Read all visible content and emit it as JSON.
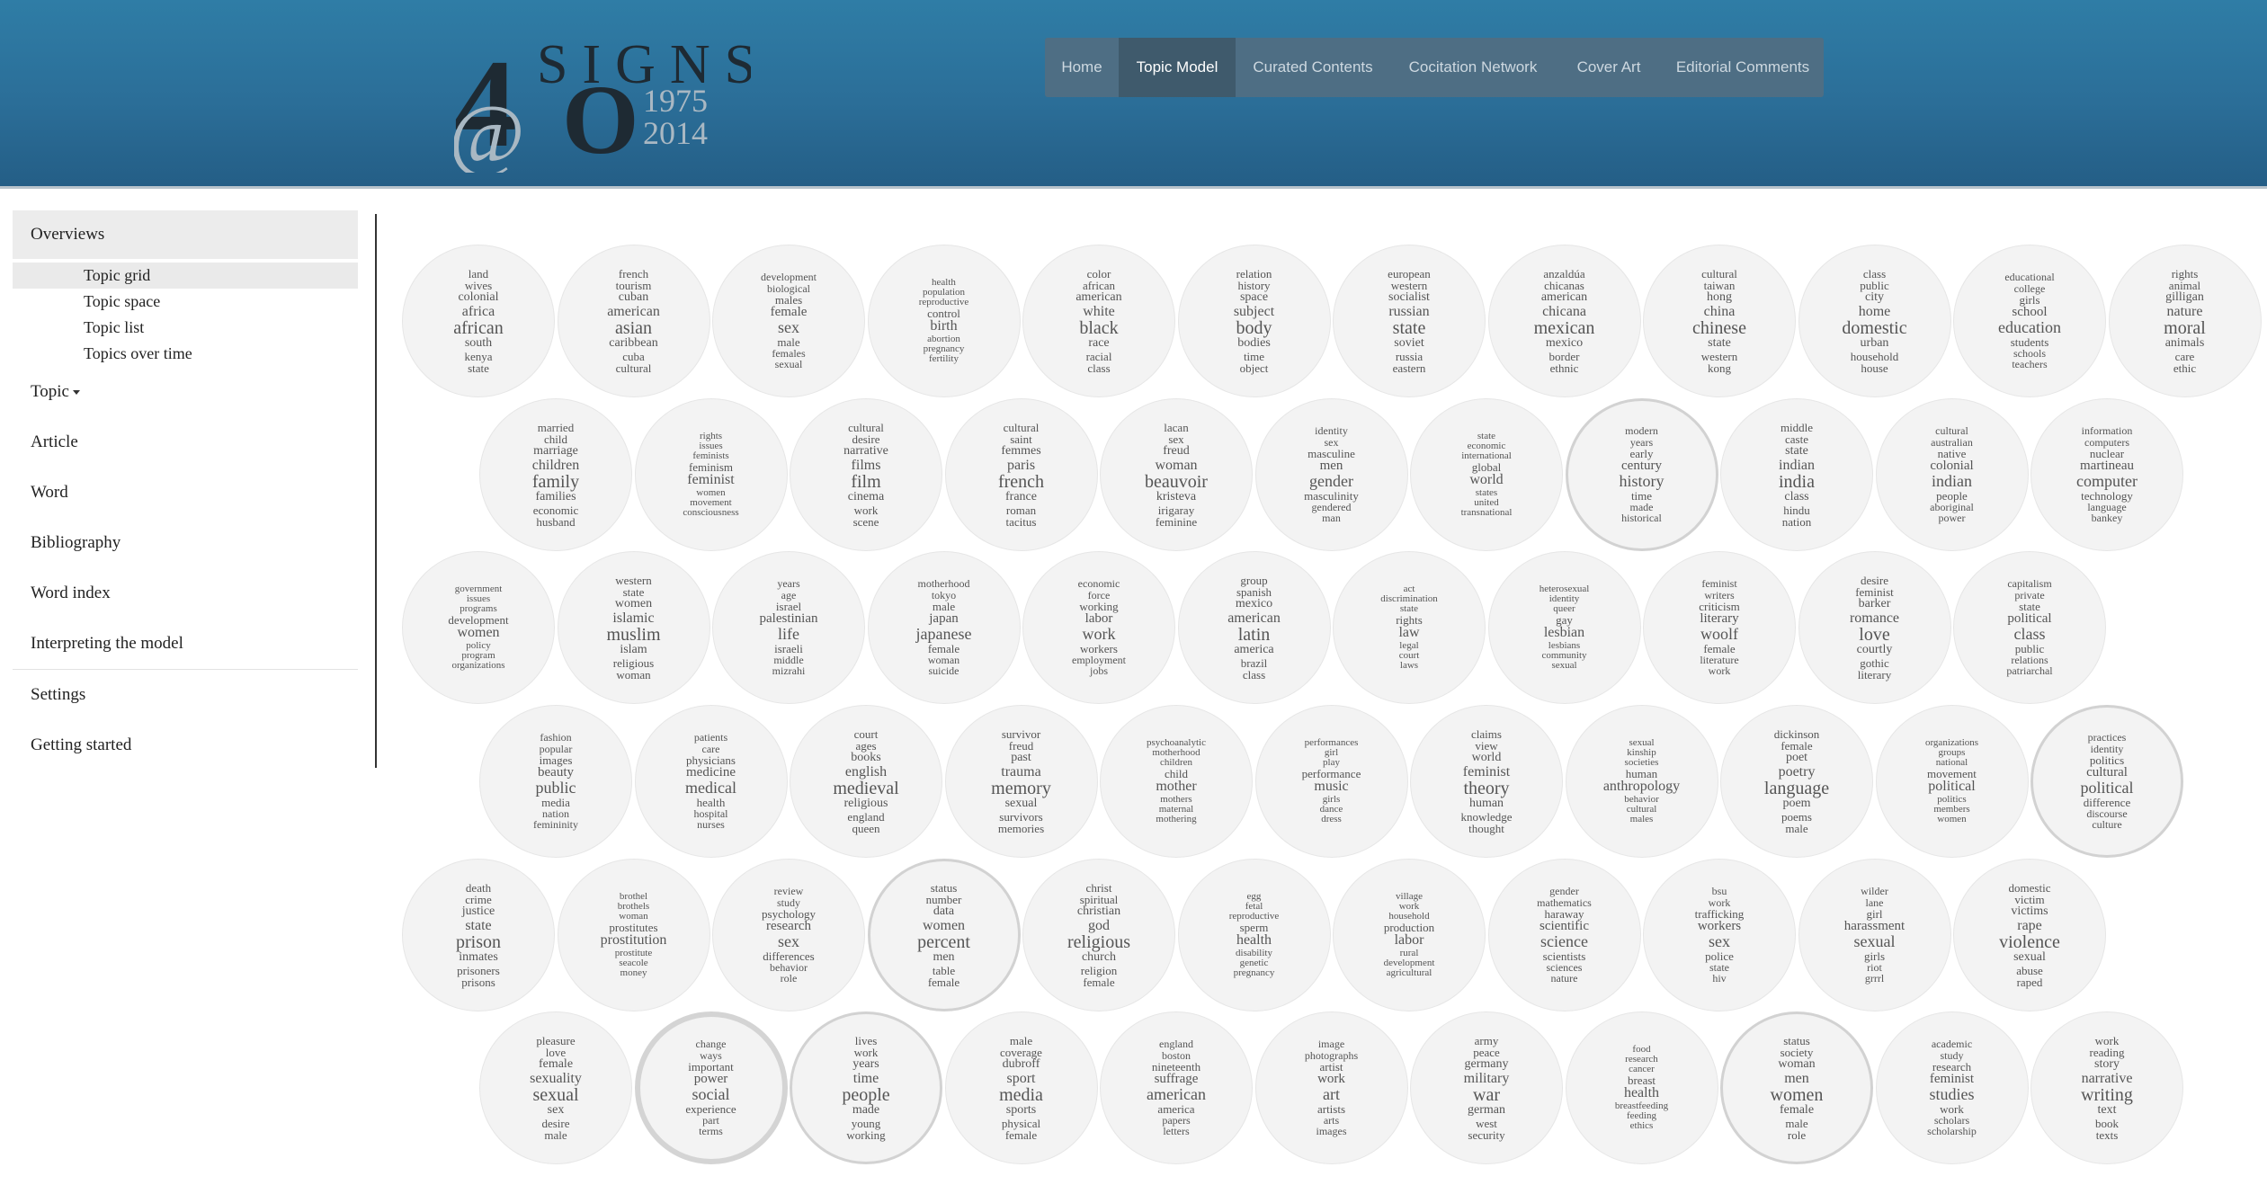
{
  "logo": {
    "numeral": "4",
    "word": "SIGNS",
    "at": "@",
    "zero": "O",
    "year_start": "1975",
    "year_end": "2014"
  },
  "nav": {
    "items": [
      {
        "label": "Home",
        "active": false
      },
      {
        "label": "Topic Model",
        "active": true
      },
      {
        "label": "Curated Contents",
        "active": false
      },
      {
        "label": "Cocitation Network",
        "active": false
      },
      {
        "label": "Cover Art",
        "active": false
      },
      {
        "label": "Editorial Comments",
        "active": false
      }
    ]
  },
  "sidebar": {
    "overviews_label": "Overviews",
    "overview_items": [
      "Topic grid",
      "Topic space",
      "Topic list",
      "Topics over time"
    ],
    "selected_overview": "Topic grid",
    "topic_label": "Topic",
    "sections": [
      "Article",
      "Word",
      "Bibliography",
      "Word index",
      "Interpreting the model"
    ],
    "bottom_sections": [
      "Settings",
      "Getting started"
    ]
  },
  "topic_rows": [
    [
      [
        "land",
        "wives",
        "colonial",
        "africa",
        "african",
        "south",
        "kenya",
        "state"
      ],
      [
        "french",
        "tourism",
        "cuban",
        "american",
        "asian",
        "caribbean",
        "cuba",
        "cultural"
      ],
      [
        "development",
        "biological",
        "males",
        "female",
        "sex",
        "male",
        "females",
        "sexual"
      ],
      [
        "health",
        "population",
        "reproductive",
        "control",
        "birth",
        "abortion",
        "pregnancy",
        "fertility"
      ],
      [
        "color",
        "african",
        "american",
        "white",
        "black",
        "race",
        "racial",
        "class"
      ],
      [
        "relation",
        "history",
        "space",
        "subject",
        "body",
        "bodies",
        "time",
        "object"
      ],
      [
        "european",
        "western",
        "socialist",
        "russian",
        "state",
        "soviet",
        "russia",
        "eastern"
      ],
      [
        "anzaldúa",
        "chicanas",
        "american",
        "chicana",
        "mexican",
        "mexico",
        "border",
        "ethnic"
      ],
      [
        "cultural",
        "taiwan",
        "hong",
        "china",
        "chinese",
        "state",
        "western",
        "kong"
      ],
      [
        "class",
        "public",
        "city",
        "home",
        "domestic",
        "urban",
        "household",
        "house"
      ],
      [
        "educational",
        "college",
        "girls",
        "school",
        "education",
        "students",
        "schools",
        "teachers"
      ],
      [
        "rights",
        "animal",
        "gilligan",
        "nature",
        "moral",
        "animals",
        "care",
        "ethic"
      ]
    ],
    [
      [
        "married",
        "child",
        "marriage",
        "children",
        "family",
        "families",
        "economic",
        "husband"
      ],
      [
        "rights",
        "issues",
        "feminists",
        "feminism",
        "feminist",
        "women",
        "movement",
        "consciousness"
      ],
      [
        "cultural",
        "desire",
        "narrative",
        "films",
        "film",
        "cinema",
        "work",
        "scene"
      ],
      [
        "cultural",
        "saint",
        "femmes",
        "paris",
        "french",
        "france",
        "roman",
        "tacitus"
      ],
      [
        "lacan",
        "sex",
        "freud",
        "woman",
        "beauvoir",
        "kristeva",
        "irigaray",
        "feminine"
      ],
      [
        "identity",
        "sex",
        "masculine",
        "men",
        "gender",
        "masculinity",
        "gendered",
        "man"
      ],
      [
        "state",
        "economic",
        "international",
        "global",
        "world",
        "states",
        "united",
        "transnational"
      ],
      [
        "modern",
        "years",
        "early",
        "century",
        "history",
        "time",
        "made",
        "historical"
      ],
      [
        "middle",
        "caste",
        "state",
        "indian",
        "india",
        "class",
        "hindu",
        "nation"
      ],
      [
        "cultural",
        "australian",
        "native",
        "colonial",
        "indian",
        "people",
        "aboriginal",
        "power"
      ],
      [
        "information",
        "computers",
        "nuclear",
        "martineau",
        "computer",
        "technology",
        "language",
        "bankey"
      ]
    ],
    [
      [
        "government",
        "issues",
        "programs",
        "development",
        "women",
        "policy",
        "program",
        "organizations"
      ],
      [
        "western",
        "state",
        "women",
        "islamic",
        "muslim",
        "islam",
        "religious",
        "woman"
      ],
      [
        "years",
        "age",
        "israel",
        "palestinian",
        "life",
        "israeli",
        "middle",
        "mizrahi"
      ],
      [
        "motherhood",
        "tokyo",
        "male",
        "japan",
        "japanese",
        "female",
        "woman",
        "suicide"
      ],
      [
        "economic",
        "force",
        "working",
        "labor",
        "work",
        "workers",
        "employment",
        "jobs"
      ],
      [
        "group",
        "spanish",
        "mexico",
        "american",
        "latin",
        "america",
        "brazil",
        "class"
      ],
      [
        "act",
        "discrimination",
        "state",
        "rights",
        "law",
        "legal",
        "court",
        "laws"
      ],
      [
        "heterosexual",
        "identity",
        "queer",
        "gay",
        "lesbian",
        "lesbians",
        "community",
        "sexual"
      ],
      [
        "feminist",
        "writers",
        "criticism",
        "literary",
        "woolf",
        "female",
        "literature",
        "work"
      ],
      [
        "desire",
        "feminist",
        "barker",
        "romance",
        "love",
        "courtly",
        "gothic",
        "literary"
      ],
      [
        "capitalism",
        "private",
        "state",
        "political",
        "class",
        "public",
        "relations",
        "patriarchal"
      ]
    ],
    [
      [
        "fashion",
        "popular",
        "images",
        "beauty",
        "public",
        "media",
        "nation",
        "femininity"
      ],
      [
        "patients",
        "care",
        "physicians",
        "medicine",
        "medical",
        "health",
        "hospital",
        "nurses"
      ],
      [
        "court",
        "ages",
        "books",
        "english",
        "medieval",
        "religious",
        "england",
        "queen"
      ],
      [
        "survivor",
        "freud",
        "past",
        "trauma",
        "memory",
        "sexual",
        "survivors",
        "memories"
      ],
      [
        "psychoanalytic",
        "motherhood",
        "children",
        "child",
        "mother",
        "mothers",
        "maternal",
        "mothering"
      ],
      [
        "performances",
        "girl",
        "play",
        "performance",
        "music",
        "girls",
        "dance",
        "dress"
      ],
      [
        "claims",
        "view",
        "world",
        "feminist",
        "theory",
        "human",
        "knowledge",
        "thought"
      ],
      [
        "sexual",
        "kinship",
        "societies",
        "human",
        "anthropology",
        "behavior",
        "cultural",
        "males"
      ],
      [
        "dickinson",
        "female",
        "poet",
        "poetry",
        "language",
        "poem",
        "poems",
        "male"
      ],
      [
        "organizations",
        "groups",
        "national",
        "movement",
        "political",
        "politics",
        "members",
        "women"
      ],
      [
        "practices",
        "identity",
        "politics",
        "cultural",
        "political",
        "difference",
        "discourse",
        "culture"
      ]
    ],
    [
      [
        "death",
        "crime",
        "justice",
        "state",
        "prison",
        "inmates",
        "prisoners",
        "prisons"
      ],
      [
        "brothel",
        "brothels",
        "woman",
        "prostitutes",
        "prostitution",
        "prostitute",
        "seacole",
        "money"
      ],
      [
        "review",
        "study",
        "psychology",
        "research",
        "sex",
        "differences",
        "behavior",
        "role"
      ],
      [
        "status",
        "number",
        "data",
        "women",
        "percent",
        "men",
        "table",
        "female"
      ],
      [
        "christ",
        "spiritual",
        "christian",
        "god",
        "religious",
        "church",
        "religion",
        "female"
      ],
      [
        "egg",
        "fetal",
        "reproductive",
        "sperm",
        "health",
        "disability",
        "genetic",
        "pregnancy"
      ],
      [
        "village",
        "work",
        "household",
        "production",
        "labor",
        "rural",
        "development",
        "agricultural"
      ],
      [
        "gender",
        "mathematics",
        "haraway",
        "scientific",
        "science",
        "scientists",
        "sciences",
        "nature"
      ],
      [
        "bsu",
        "work",
        "trafficking",
        "workers",
        "sex",
        "police",
        "state",
        "hiv"
      ],
      [
        "wilder",
        "lane",
        "girl",
        "harassment",
        "sexual",
        "girls",
        "riot",
        "grrrl"
      ],
      [
        "domestic",
        "victim",
        "victims",
        "rape",
        "violence",
        "sexual",
        "abuse",
        "raped"
      ]
    ],
    [
      [
        "pleasure",
        "love",
        "female",
        "sexuality",
        "sexual",
        "sex",
        "desire",
        "male"
      ],
      [
        "change",
        "ways",
        "important",
        "power",
        "social",
        "experience",
        "part",
        "terms"
      ],
      [
        "lives",
        "work",
        "years",
        "time",
        "people",
        "made",
        "young",
        "working"
      ],
      [
        "male",
        "coverage",
        "dubroff",
        "sport",
        "media",
        "sports",
        "physical",
        "female"
      ],
      [
        "england",
        "boston",
        "nineteenth",
        "suffrage",
        "american",
        "america",
        "papers",
        "letters"
      ],
      [
        "image",
        "photographs",
        "artist",
        "work",
        "art",
        "artists",
        "arts",
        "images"
      ],
      [
        "army",
        "peace",
        "germany",
        "military",
        "war",
        "german",
        "west",
        "security"
      ],
      [
        "food",
        "research",
        "cancer",
        "breast",
        "health",
        "breastfeeding",
        "feeding",
        "ethics"
      ],
      [
        "status",
        "society",
        "woman",
        "men",
        "women",
        "female",
        "male",
        "role"
      ],
      [
        "academic",
        "study",
        "research",
        "feminist",
        "studies",
        "work",
        "scholars",
        "scholarship"
      ],
      [
        "work",
        "reading",
        "story",
        "narrative",
        "writing",
        "text",
        "book",
        "texts"
      ]
    ]
  ]
}
